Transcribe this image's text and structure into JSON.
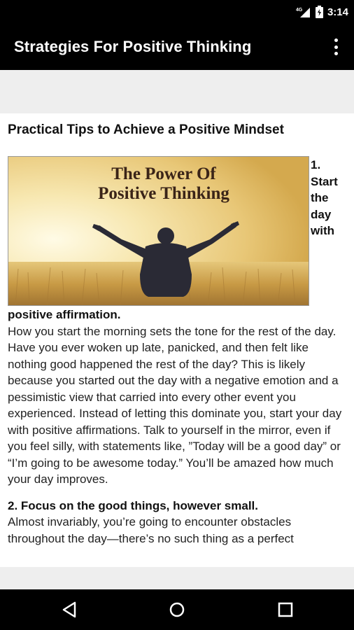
{
  "status": {
    "time": "3:14",
    "network": "4G"
  },
  "app_bar": {
    "title": "Strategies For Positive Thinking",
    "menu_icon": "overflow-menu-icon"
  },
  "article": {
    "heading": "Practical Tips to Achieve a Positive Mindset",
    "image": {
      "title_line1": "The Power Of",
      "title_line2": "Positive Thinking"
    },
    "wrap_words": [
      "1.",
      "Start",
      "the",
      "day",
      "with"
    ],
    "tip1_rest": "positive affirmation.",
    "tip1_body": "How you start the morning sets the tone for the rest of the day. Have you ever woken up late, panicked, and then felt like nothing good happened the rest of the day? This is likely because you started out the day with a negative emotion and a pessimistic view that carried into every other event you experienced. Instead of letting this dominate you, start your day with positive affirmations. Talk to yourself in the mirror, even if you feel silly, with statements like, ”Today will be a good day” or “I’m going to be awesome today.” You’ll be amazed how much your day improves.",
    "tip2_title": "2. Focus on the good things, however small.",
    "tip2_body": "Almost invariably, you’re going to encounter obstacles throughout the day—there’s no such thing as a perfect"
  },
  "nav": {
    "back": "back-icon",
    "home": "home-icon",
    "recents": "recents-icon"
  }
}
